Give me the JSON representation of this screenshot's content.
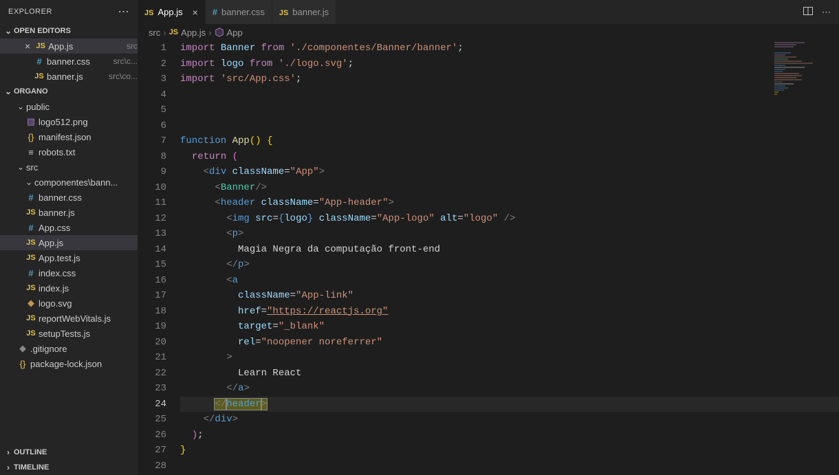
{
  "explorer": {
    "title": "EXPLORER"
  },
  "openEditors": {
    "title": "OPEN EDITORS",
    "items": [
      {
        "icon": "js",
        "name": "App.js",
        "meta": "src",
        "active": true
      },
      {
        "icon": "css",
        "name": "banner.css",
        "meta": "src\\c..."
      },
      {
        "icon": "js",
        "name": "banner.js",
        "meta": "src\\co..."
      }
    ]
  },
  "project": {
    "name": "ORGANO",
    "tree": [
      {
        "type": "folder",
        "name": "public",
        "indent": 1,
        "open": true
      },
      {
        "type": "file",
        "name": "logo512.png",
        "icon": "img",
        "indent": 2
      },
      {
        "type": "file",
        "name": "manifest.json",
        "icon": "json",
        "indent": 2
      },
      {
        "type": "file",
        "name": "robots.txt",
        "icon": "txt",
        "indent": 2
      },
      {
        "type": "folder",
        "name": "src",
        "indent": 1,
        "open": true
      },
      {
        "type": "folder",
        "name": "componentes\\bann...",
        "indent": 2,
        "open": true
      },
      {
        "type": "file",
        "name": "banner.css",
        "icon": "css",
        "indent": 3
      },
      {
        "type": "file",
        "name": "banner.js",
        "icon": "js",
        "indent": 3
      },
      {
        "type": "file",
        "name": "App.css",
        "icon": "css",
        "indent": 2
      },
      {
        "type": "file",
        "name": "App.js",
        "icon": "js",
        "indent": 2,
        "active": true
      },
      {
        "type": "file",
        "name": "App.test.js",
        "icon": "js",
        "indent": 2
      },
      {
        "type": "file",
        "name": "index.css",
        "icon": "css",
        "indent": 2
      },
      {
        "type": "file",
        "name": "index.js",
        "icon": "js",
        "indent": 2
      },
      {
        "type": "file",
        "name": "logo.svg",
        "icon": "svg",
        "indent": 2
      },
      {
        "type": "file",
        "name": "reportWebVitals.js",
        "icon": "js",
        "indent": 2
      },
      {
        "type": "file",
        "name": "setupTests.js",
        "icon": "js",
        "indent": 2
      },
      {
        "type": "file",
        "name": ".gitignore",
        "icon": "git",
        "indent": 1
      },
      {
        "type": "file",
        "name": "package-lock.json",
        "icon": "json",
        "indent": 1
      }
    ]
  },
  "outline": {
    "title": "OUTLINE"
  },
  "timeline": {
    "title": "TIMELINE"
  },
  "tabs": [
    {
      "icon": "js",
      "name": "App.js",
      "active": true,
      "close": true
    },
    {
      "icon": "css",
      "name": "banner.css"
    },
    {
      "icon": "js",
      "name": "banner.js"
    }
  ],
  "breadcrumb": {
    "parts": [
      "src",
      "App.js",
      "App"
    ]
  },
  "code": {
    "lines": [
      [
        {
          "c": "k-import",
          "t": "import"
        },
        {
          "c": "k-white",
          "t": " "
        },
        {
          "c": "k-name",
          "t": "Banner"
        },
        {
          "c": "k-white",
          "t": " "
        },
        {
          "c": "k-import",
          "t": "from"
        },
        {
          "c": "k-white",
          "t": " "
        },
        {
          "c": "k-str",
          "t": "'./componentes/Banner/banner'"
        },
        {
          "c": "k-white",
          "t": ";"
        }
      ],
      [
        {
          "c": "k-import",
          "t": "import"
        },
        {
          "c": "k-white",
          "t": " "
        },
        {
          "c": "k-name",
          "t": "logo"
        },
        {
          "c": "k-white",
          "t": " "
        },
        {
          "c": "k-import",
          "t": "from"
        },
        {
          "c": "k-white",
          "t": " "
        },
        {
          "c": "k-str",
          "t": "'./logo.svg'"
        },
        {
          "c": "k-white",
          "t": ";"
        }
      ],
      [
        {
          "c": "k-import",
          "t": "import"
        },
        {
          "c": "k-white",
          "t": " "
        },
        {
          "c": "k-str",
          "t": "'src/App.css'"
        },
        {
          "c": "k-white",
          "t": ";"
        }
      ],
      [],
      [],
      [],
      [
        {
          "c": "k-func",
          "t": "function"
        },
        {
          "c": "k-white",
          "t": " "
        },
        {
          "c": "k-fn",
          "t": "App"
        },
        {
          "c": "k-brace",
          "t": "()"
        },
        {
          "c": "k-white",
          "t": " "
        },
        {
          "c": "k-brace",
          "t": "{"
        }
      ],
      [
        {
          "c": "k-white",
          "t": "  "
        },
        {
          "c": "k-return",
          "t": "return"
        },
        {
          "c": "k-white",
          "t": " "
        },
        {
          "c": "k-brace2",
          "t": "("
        }
      ],
      [
        {
          "c": "k-white",
          "t": "    "
        },
        {
          "c": "k-angle",
          "t": "<"
        },
        {
          "c": "k-tag",
          "t": "div"
        },
        {
          "c": "k-white",
          "t": " "
        },
        {
          "c": "k-attr",
          "t": "className"
        },
        {
          "c": "k-white",
          "t": "="
        },
        {
          "c": "k-str",
          "t": "\"App\""
        },
        {
          "c": "k-angle",
          "t": ">"
        }
      ],
      [
        {
          "c": "k-white",
          "t": "      "
        },
        {
          "c": "k-angle",
          "t": "<"
        },
        {
          "c": "k-tagname",
          "t": "Banner"
        },
        {
          "c": "k-angle",
          "t": "/>"
        }
      ],
      [
        {
          "c": "k-white",
          "t": "      "
        },
        {
          "c": "k-angle",
          "t": "<"
        },
        {
          "c": "k-tag",
          "t": "header"
        },
        {
          "c": "k-white",
          "t": " "
        },
        {
          "c": "k-attr",
          "t": "className"
        },
        {
          "c": "k-white",
          "t": "="
        },
        {
          "c": "k-str",
          "t": "\"App-header\""
        },
        {
          "c": "k-angle",
          "t": ">"
        }
      ],
      [
        {
          "c": "k-white",
          "t": "        "
        },
        {
          "c": "k-angle",
          "t": "<"
        },
        {
          "c": "k-tag",
          "t": "img"
        },
        {
          "c": "k-white",
          "t": " "
        },
        {
          "c": "k-attr",
          "t": "src"
        },
        {
          "c": "k-white",
          "t": "="
        },
        {
          "c": "k-tag",
          "t": "{"
        },
        {
          "c": "k-name",
          "t": "logo"
        },
        {
          "c": "k-tag",
          "t": "}"
        },
        {
          "c": "k-white",
          "t": " "
        },
        {
          "c": "k-attr",
          "t": "className"
        },
        {
          "c": "k-white",
          "t": "="
        },
        {
          "c": "k-str",
          "t": "\"App-logo\""
        },
        {
          "c": "k-white",
          "t": " "
        },
        {
          "c": "k-attr",
          "t": "alt"
        },
        {
          "c": "k-white",
          "t": "="
        },
        {
          "c": "k-str",
          "t": "\"logo\""
        },
        {
          "c": "k-white",
          "t": " "
        },
        {
          "c": "k-angle",
          "t": "/>"
        }
      ],
      [
        {
          "c": "k-white",
          "t": "        "
        },
        {
          "c": "k-angle",
          "t": "<"
        },
        {
          "c": "k-tag",
          "t": "p"
        },
        {
          "c": "k-angle",
          "t": ">"
        }
      ],
      [
        {
          "c": "k-white",
          "t": "          Magia Negra da computação front-end"
        }
      ],
      [
        {
          "c": "k-white",
          "t": "        "
        },
        {
          "c": "k-angle",
          "t": "</"
        },
        {
          "c": "k-tag",
          "t": "p"
        },
        {
          "c": "k-angle",
          "t": ">"
        }
      ],
      [
        {
          "c": "k-white",
          "t": "        "
        },
        {
          "c": "k-angle",
          "t": "<"
        },
        {
          "c": "k-tag",
          "t": "a"
        }
      ],
      [
        {
          "c": "k-white",
          "t": "          "
        },
        {
          "c": "k-attr",
          "t": "className"
        },
        {
          "c": "k-white",
          "t": "="
        },
        {
          "c": "k-str",
          "t": "\"App-link\""
        }
      ],
      [
        {
          "c": "k-white",
          "t": "          "
        },
        {
          "c": "k-attr",
          "t": "href"
        },
        {
          "c": "k-white",
          "t": "="
        },
        {
          "c": "k-url",
          "t": "\"https://reactjs.org\""
        }
      ],
      [
        {
          "c": "k-white",
          "t": "          "
        },
        {
          "c": "k-attr",
          "t": "target"
        },
        {
          "c": "k-white",
          "t": "="
        },
        {
          "c": "k-str",
          "t": "\"_blank\""
        }
      ],
      [
        {
          "c": "k-white",
          "t": "          "
        },
        {
          "c": "k-attr",
          "t": "rel"
        },
        {
          "c": "k-white",
          "t": "="
        },
        {
          "c": "k-str",
          "t": "\"noopener noreferrer\""
        }
      ],
      [
        {
          "c": "k-white",
          "t": "        "
        },
        {
          "c": "k-angle",
          "t": ">"
        }
      ],
      [
        {
          "c": "k-white",
          "t": "          Learn React"
        }
      ],
      [
        {
          "c": "k-white",
          "t": "        "
        },
        {
          "c": "k-angle",
          "t": "</"
        },
        {
          "c": "k-tag",
          "t": "a"
        },
        {
          "c": "k-angle",
          "t": ">"
        }
      ],
      [
        {
          "c": "k-white",
          "t": "      "
        },
        {
          "sel": true,
          "c": "k-angle",
          "t": "</"
        },
        {
          "sel": true,
          "c": "k-tag",
          "t": "header"
        },
        {
          "sel": true,
          "c": "k-angle",
          "t": ">"
        }
      ],
      [
        {
          "c": "k-white",
          "t": "    "
        },
        {
          "c": "k-angle",
          "t": "</"
        },
        {
          "c": "k-tag",
          "t": "div"
        },
        {
          "c": "k-angle",
          "t": ">"
        }
      ],
      [
        {
          "c": "k-white",
          "t": "  "
        },
        {
          "c": "k-brace2",
          "t": ")"
        },
        {
          "c": "k-white",
          "t": ";"
        }
      ],
      [
        {
          "c": "k-brace",
          "t": "}"
        }
      ],
      []
    ],
    "currentLine": 24
  }
}
